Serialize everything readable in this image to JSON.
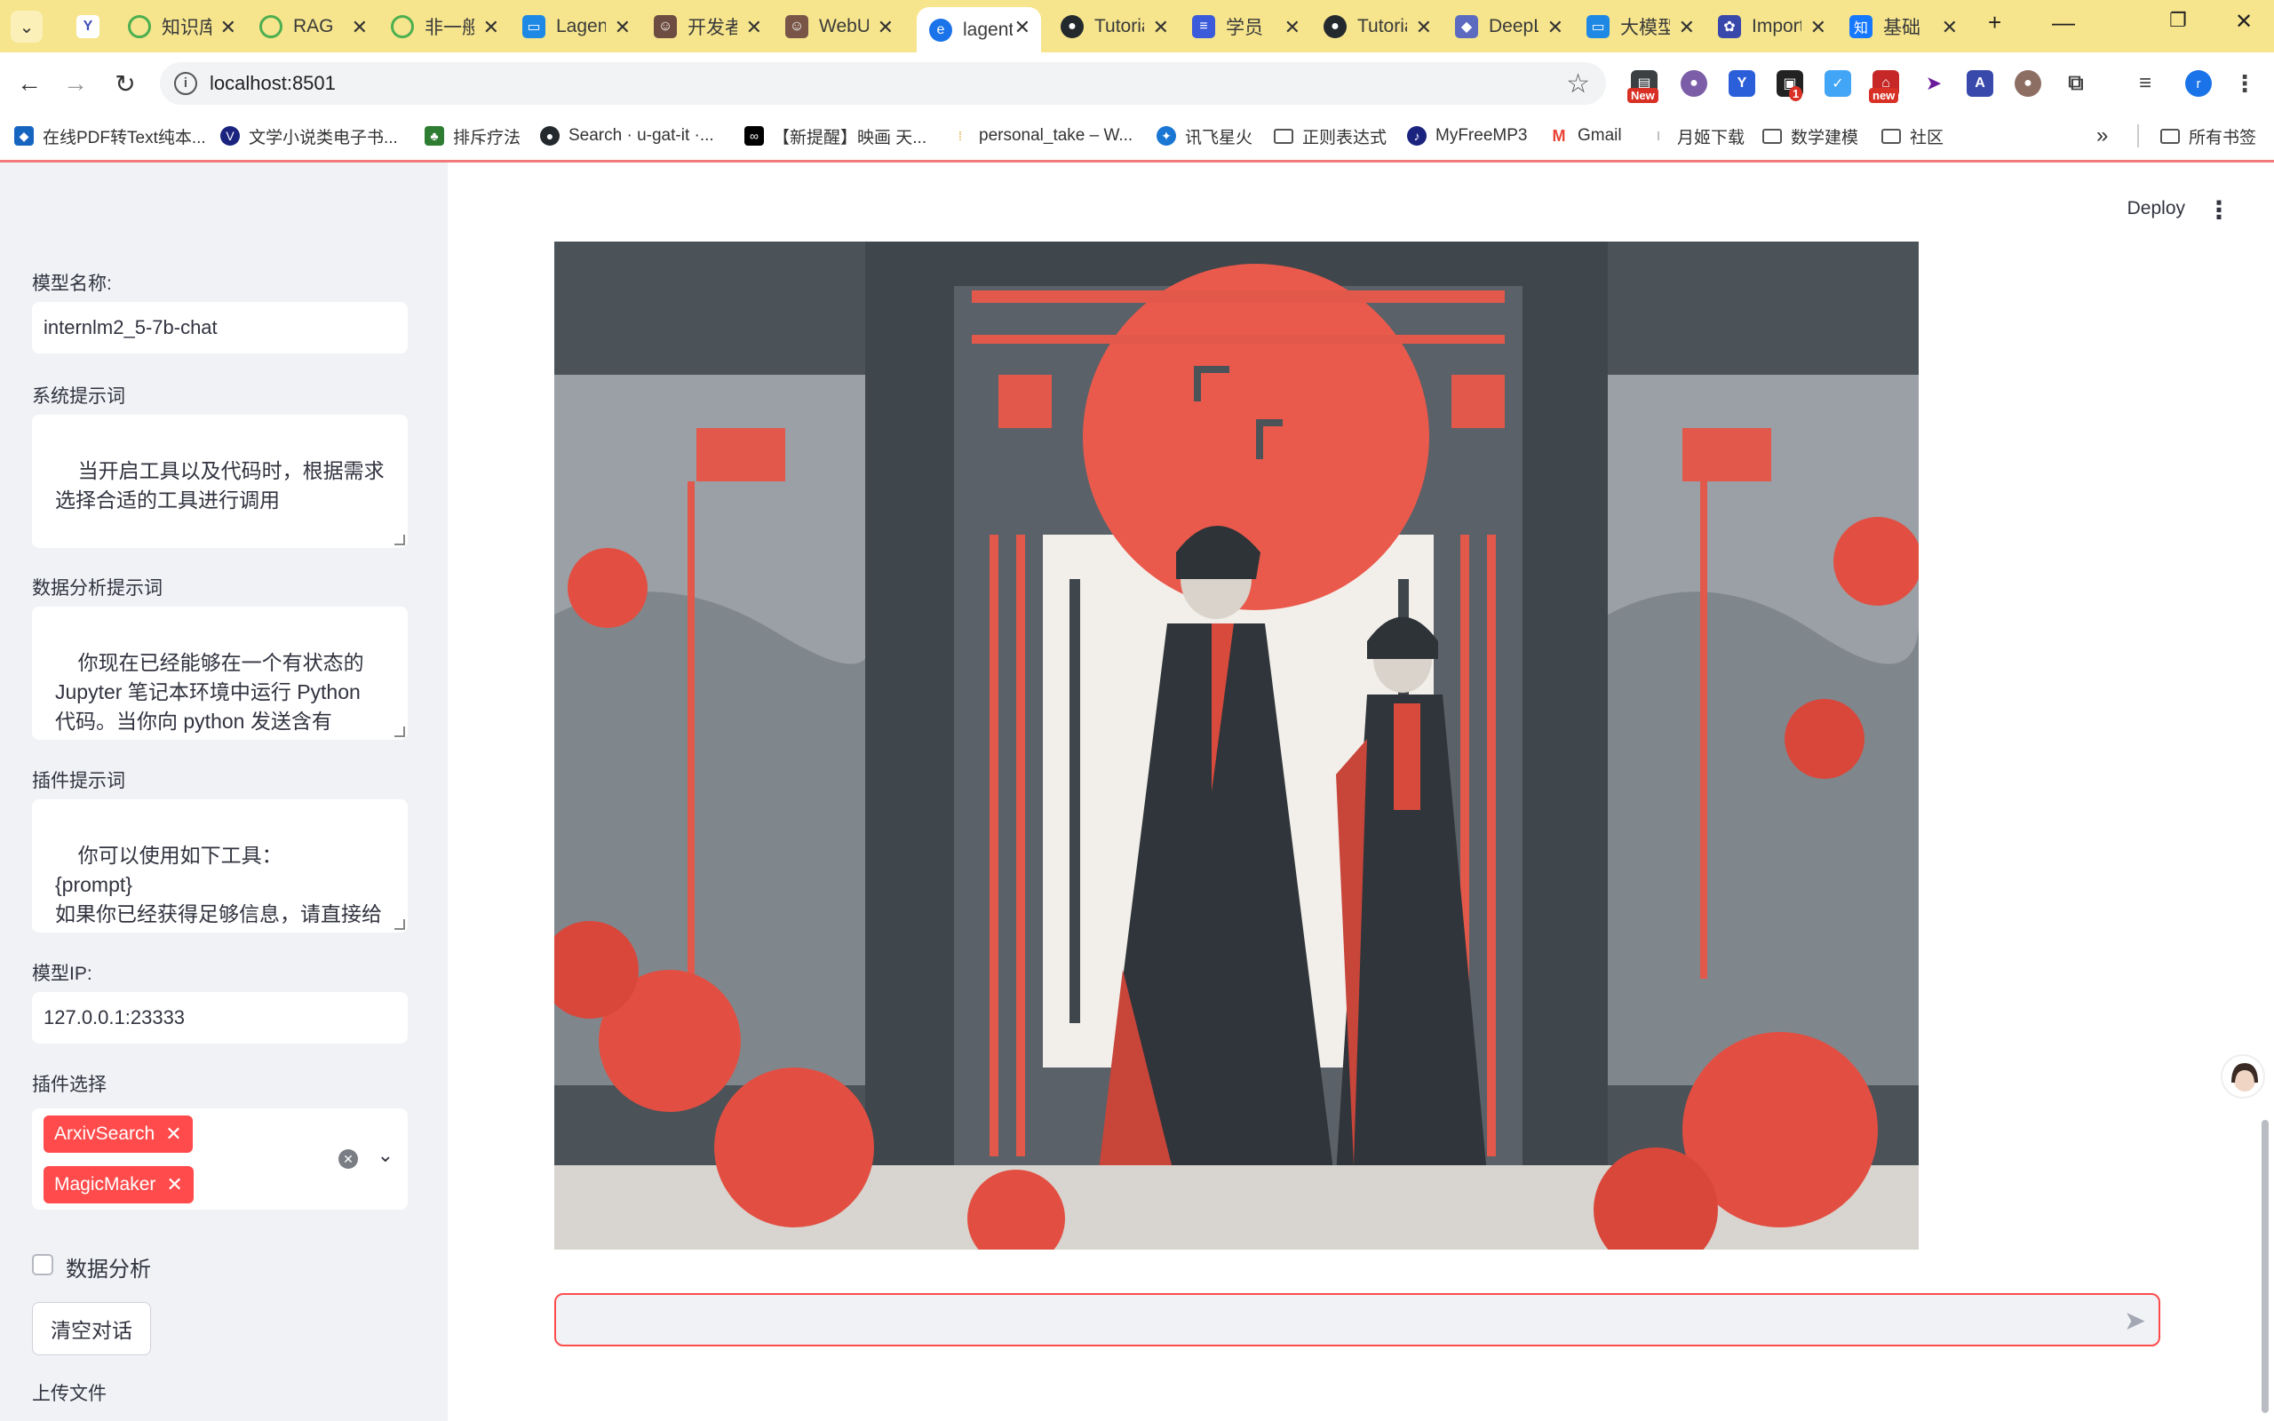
{
  "browser": {
    "tabs": [
      {
        "title": "知识库"
      },
      {
        "title": "RAG"
      },
      {
        "title": "非一般"
      },
      {
        "title": "Lagent"
      },
      {
        "title": "开发者"
      },
      {
        "title": "WebUI"
      },
      {
        "title": "lagent"
      },
      {
        "title": "Tutorial"
      },
      {
        "title": "学员"
      },
      {
        "title": "Tutorial"
      },
      {
        "title": "DeepL"
      },
      {
        "title": "大模型"
      },
      {
        "title": "Import"
      },
      {
        "title": "基础"
      }
    ],
    "active_tab_index": 6,
    "url": "localhost:8501",
    "extension_badges": {
      "new_upper": "New",
      "count": "1",
      "new_lower": "new",
      "profile": "r"
    },
    "bookmarks": [
      "在线PDF转Text纯本...",
      "文学小说类电子书...",
      "排斥疗法",
      "Search · u-gat-it ·...",
      "【新提醒】映画 天...",
      "personal_take – W...",
      "讯飞星火",
      "正则表达式",
      "MyFreeMP3",
      "Gmail",
      "月姬下载",
      "数学建模",
      "社区"
    ],
    "all_bookmarks": "所有书签",
    "more_bookmarks": "»"
  },
  "sidebar": {
    "model_name_label": "模型名称:",
    "model_name_value": "internlm2_5-7b-chat",
    "system_prompt_label": "系统提示词",
    "system_prompt_value": "当开启工具以及代码时，根据需求选择合适的工具进行调用",
    "data_analysis_prompt_label": "数据分析提示词",
    "data_analysis_prompt_value": "你现在已经能够在一个有状态的 Jupyter 笔记本环境中运行 Python 代码。当你向 python 发送含有 Python 代码的消息时，它将在该",
    "plugin_prompt_label": "插件提示词",
    "plugin_prompt_value": "你可以使用如下工具：\n{prompt}\n如果你已经获得足够信息，请直接给出答案. 避免不必要的工具调用!",
    "model_ip_label": "模型IP:",
    "model_ip_value": "127.0.0.1:23333",
    "plugin_select_label": "插件选择",
    "plugins_selected": [
      "ArxivSearch",
      "MagicMaker"
    ],
    "data_analysis_checkbox_label": "数据分析",
    "data_analysis_checked": false,
    "clear_button_label": "清空对话",
    "upload_label": "上传文件"
  },
  "main": {
    "deploy_label": "Deploy",
    "chat_input_placeholder": ""
  },
  "colors": {
    "tabbar": "#f6e58d",
    "streamlit_primary": "#ff4b4b",
    "sidebar_bg": "#f0f2f6"
  }
}
